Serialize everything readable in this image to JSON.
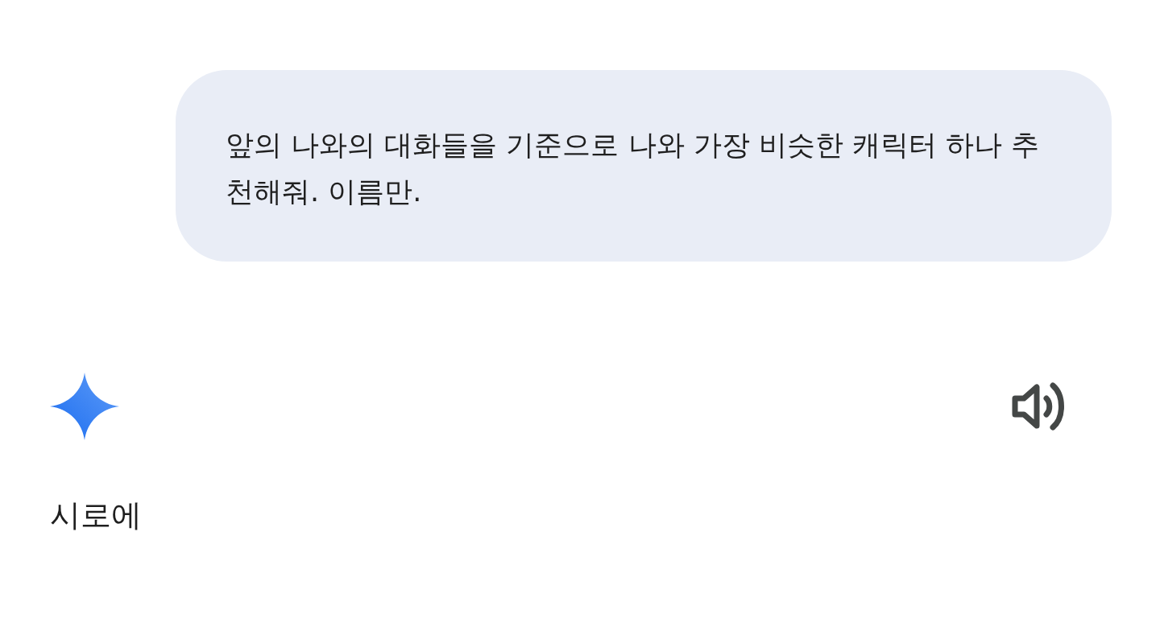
{
  "user_message": {
    "text": "앞의 나와의 대화들을 기준으로 나와 가장 비슷한 캐릭터 하나 추천해줘. 이름만."
  },
  "response": {
    "text": "시로에"
  }
}
